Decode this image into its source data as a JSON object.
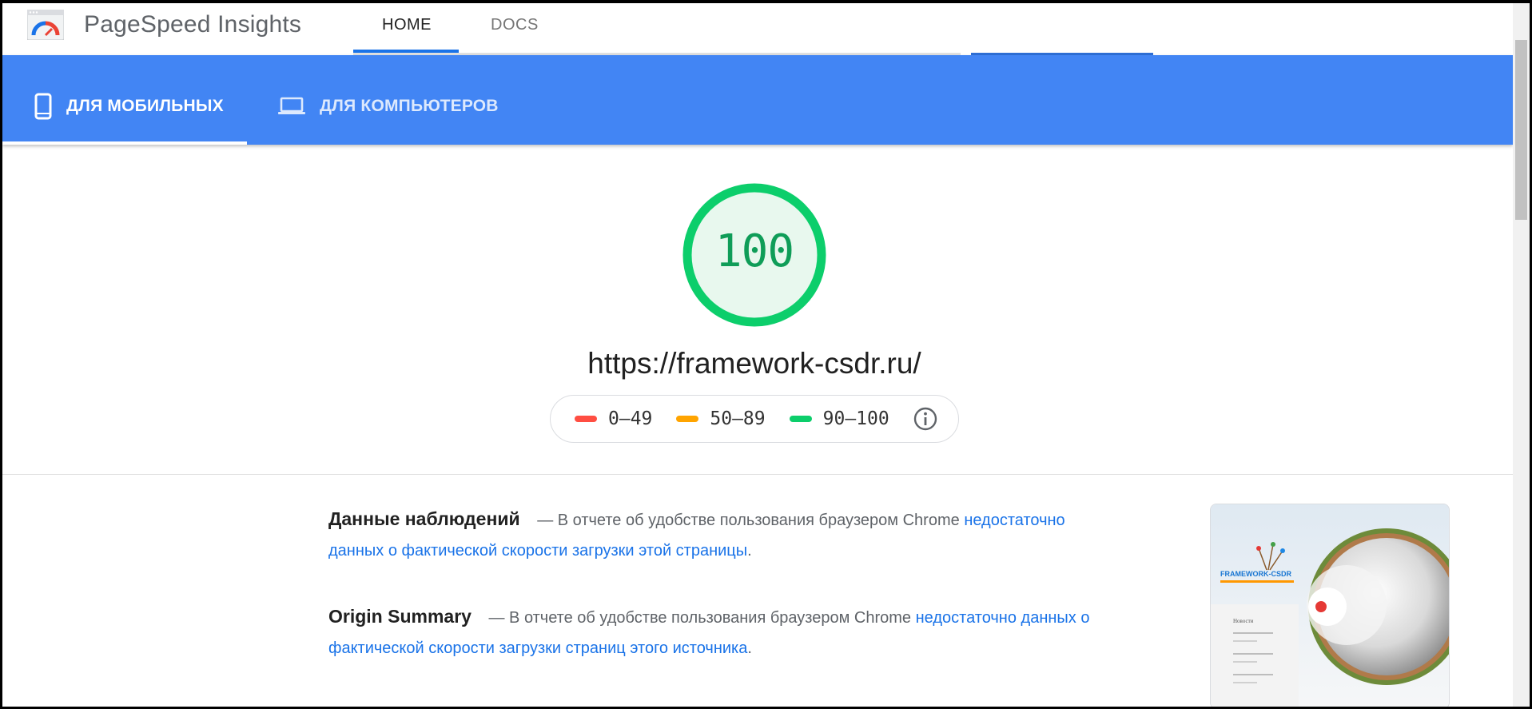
{
  "header": {
    "app_title": "PageSpeed Insights",
    "nav": {
      "home_label": "HOME",
      "docs_label": "DOCS"
    }
  },
  "device_tabs": {
    "mobile_label": "ДЛЯ МОБИЛЬНЫХ",
    "desktop_label": "ДЛЯ КОМПЬЮТЕРОВ"
  },
  "report": {
    "score": "100",
    "url": "https://framework-csdr.ru/",
    "legend": {
      "low": "0–49",
      "mid": "50–89",
      "high": "90–100"
    },
    "colors": {
      "low": "#ff4e42",
      "mid": "#ffa400",
      "high": "#0cce6b",
      "accent_blue": "#4285f4"
    }
  },
  "field_data": {
    "title": "Данные наблюдений",
    "text": "— В отчете об удобстве пользования браузером Chrome",
    "link": "недостаточно данных о фактической скорости загрузки этой страницы",
    "tail": "."
  },
  "origin_summary": {
    "title": "Origin Summary",
    "text": "— В отчете об удобстве пользования браузером Chrome",
    "link": "недостаточно данных о фактической скорости загрузки страниц этого источника",
    "tail": "."
  },
  "thumbnail": {
    "logo_text": "FRAMEWORK-CSDR",
    "menu_item": "Новости"
  }
}
